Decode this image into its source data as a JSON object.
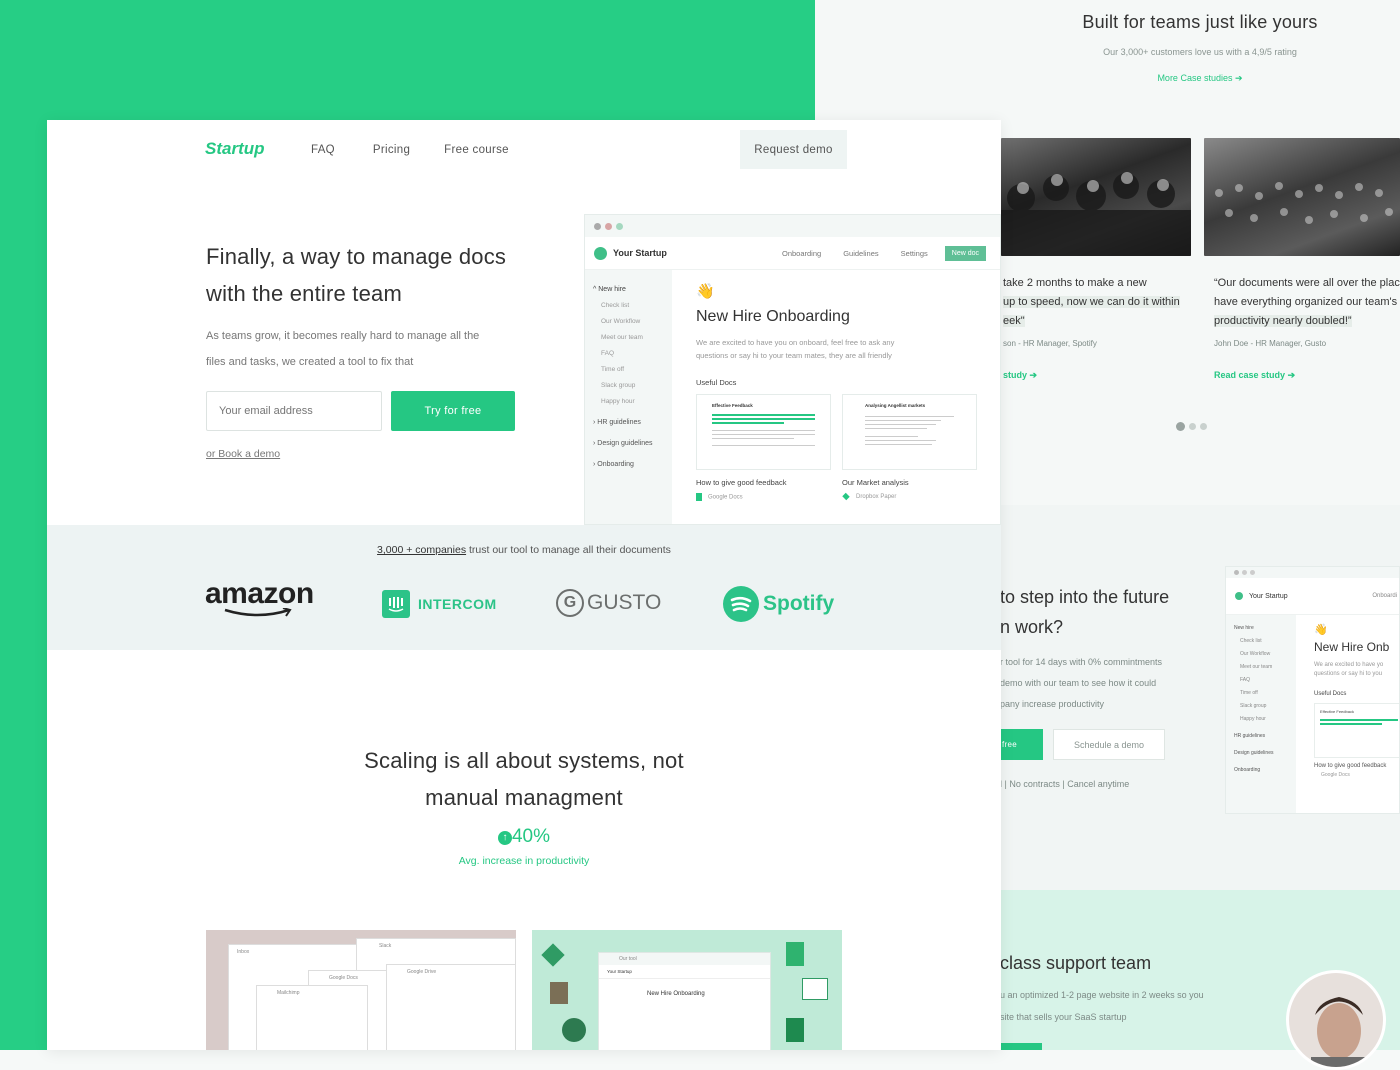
{
  "colors": {
    "accent": "#25c783",
    "background_green": "#26ce85"
  },
  "back_page": {
    "title": "Built for teams just like yours",
    "subtitle": "Our 3,000+ customers love us with a 4,9/5 rating",
    "more_link": "More Case studies",
    "cases": [
      {
        "quote_l1": "take 2 months to make a new",
        "quote_l2": "up to speed, now we can do it within",
        "quote_l3": "eek\"",
        "author": "son - HR Manager, Spotify",
        "link": "study"
      },
      {
        "quote_l1": "“Our documents were all over the place",
        "quote_l2": "have everything organized our team's",
        "quote_l3": "productivity nearly doubled!”",
        "author": "John Doe - HR Manager, Gusto",
        "link": "Read case study"
      }
    ],
    "cta": {
      "heading_l1": "to step into the future",
      "heading_l2": "n work?",
      "line1": "r tool for 14 days with 0% commintments",
      "line2": "demo with our team to see how it could",
      "line3": "pany increase productivity",
      "primary": "free",
      "secondary": "Schedule a demo",
      "note": "l | No contracts | Cancel anytime"
    },
    "mini_app": {
      "brand": "Your Startup",
      "tab": "Onboardi",
      "side": [
        "New hire",
        "Check list",
        "Our Workflow",
        "Meet our team",
        "FAQ",
        "Time off",
        "Slack group",
        "Happy hour",
        "HR guidelines",
        "Design guidelines",
        "Onboarding"
      ],
      "doc_title": "New Hire Onb",
      "doc_text_l1": "We are excited to have yo",
      "doc_text_l2": "questions or say hi to you",
      "useful": "Useful Docs",
      "card_title": "Effective Feedback",
      "card_caption": "How to give good feedback",
      "card_source": "Google Docs"
    },
    "support": {
      "heading": "class support team",
      "line1": "u an optimized 1-2 page website in 2 weeks so you",
      "line2": "site that sells your SaaS startup"
    }
  },
  "nav": {
    "brand": "Startup",
    "links": [
      "FAQ",
      "Pricing",
      "Free course"
    ],
    "cta": "Request demo"
  },
  "hero": {
    "heading_l1": "Finally, a way to manage docs",
    "heading_l2": "with the entire team",
    "text_l1": "As teams grow, it becomes really hard to manage all the",
    "text_l2": "files and tasks, we created a tool to fix that",
    "email_placeholder": "Your email address",
    "try_button": "Try for free",
    "book_link": "or Book a demo"
  },
  "app": {
    "brand": "Your Startup",
    "tabs": [
      "Onboarding",
      "Guidelines",
      "Settings"
    ],
    "new_doc": "New doc",
    "side_main": "New hire",
    "side_items": [
      "Check list",
      "Our Workflow",
      "Meet our team",
      "FAQ",
      "Time off",
      "Slack group",
      "Happy hour"
    ],
    "side_groups": [
      "HR guidelines",
      "Design guidelines",
      "Onboarding"
    ],
    "emoji": "👋",
    "doc_title": "New Hire Onboarding",
    "doc_text_l1": "We are excited to have you on onboard, feel free to ask any",
    "doc_text_l2": "questions or say hi to your team mates, they are all friendly",
    "useful": "Useful Docs",
    "cards": [
      {
        "title": "Effective Feedback",
        "caption": "How to give good feedback",
        "source": "Google Docs"
      },
      {
        "title": "Analysing Angellist markets",
        "caption": "Our Market analysis",
        "source": "Dropbox Paper"
      }
    ]
  },
  "trust": {
    "link": "3,000 + companies",
    "rest": " trust our tool to manage all their documents",
    "logos": [
      "amazon",
      "INTERCOM",
      "GUSTO",
      "Spotify"
    ]
  },
  "scaling": {
    "heading_l1": "Scaling is all about systems, not",
    "heading_l2": "manual managment",
    "stat": "40%",
    "stat_label": "Avg. increase in productivity"
  },
  "thumbs": {
    "left_tabs": [
      "Inbox",
      "Slack",
      "Google Docs",
      "Google Drive",
      "Mailchimp"
    ],
    "right_title": "Our tool",
    "right_brand": "Your Startup",
    "right_doc": "New Hire Onboarding"
  }
}
